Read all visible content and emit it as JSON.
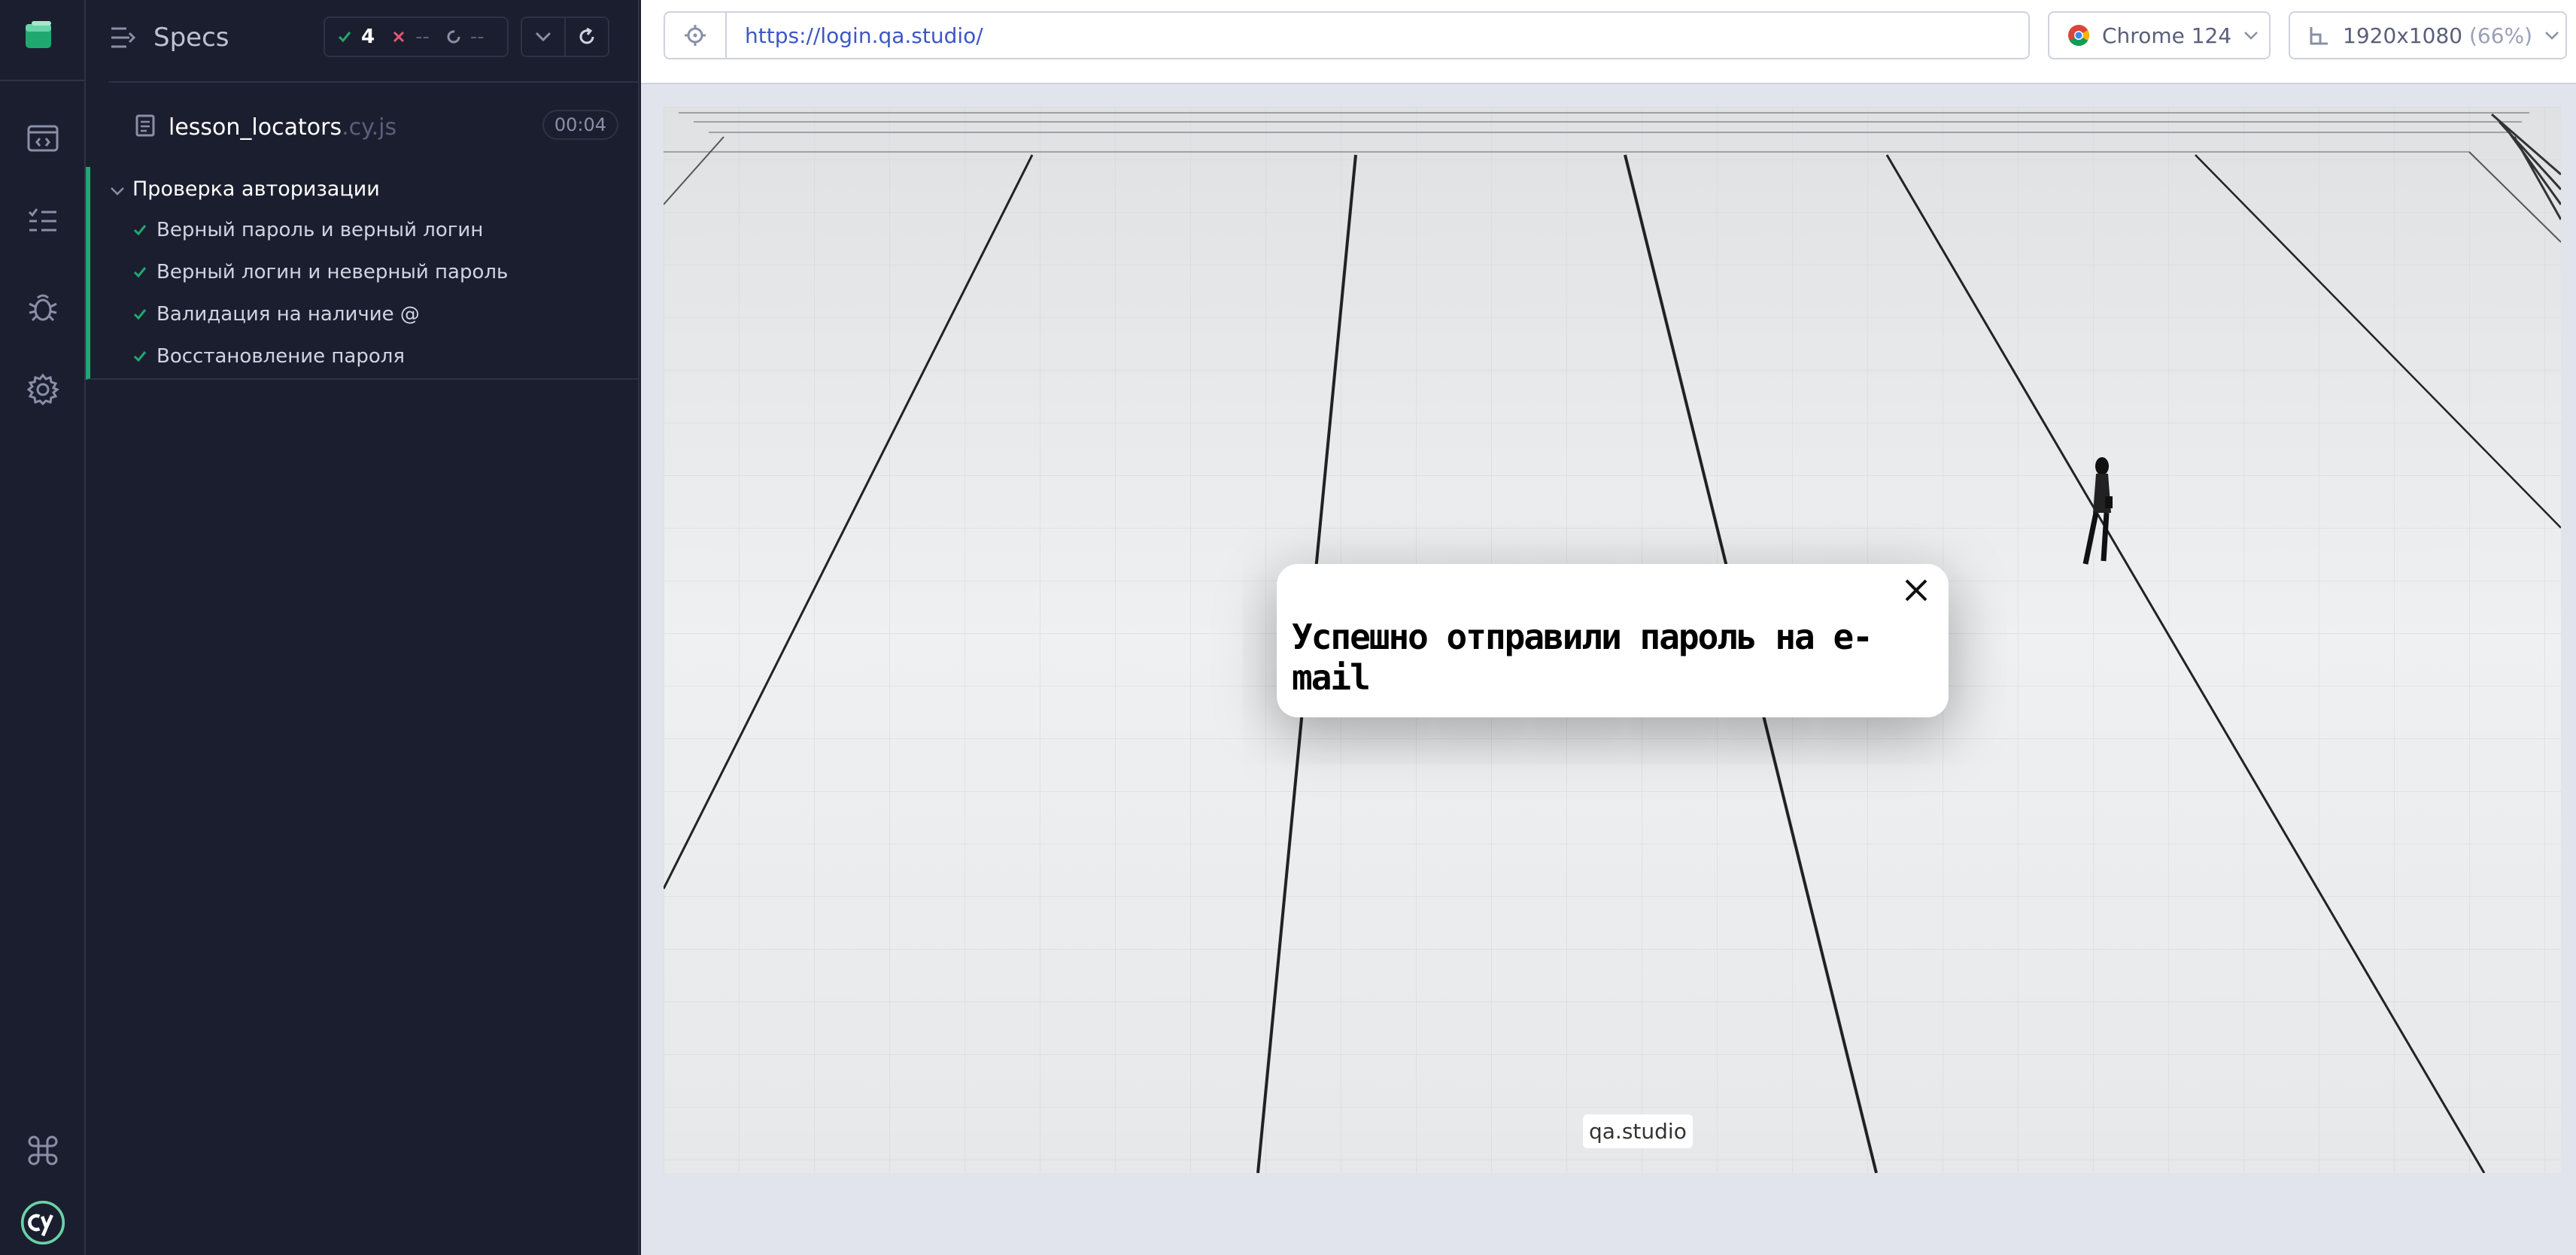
{
  "sidebar": {
    "icons": [
      "app-logo-icon",
      "browser-window-icon",
      "test-list-icon",
      "bug-icon",
      "settings-gear-icon",
      "command-icon",
      "cypress-logo-icon"
    ]
  },
  "specs_panel": {
    "title": "Specs",
    "stats": {
      "passed": "4",
      "failed": "--",
      "pending": "--"
    },
    "spec_file": {
      "name": "lesson_locators",
      "ext": ".cy.js",
      "duration": "00:04"
    },
    "suite": {
      "title": "Проверка авторизации",
      "tests": [
        {
          "label": "Верный пароль и верный логин"
        },
        {
          "label": "Верный логин и неверный пароль"
        },
        {
          "label": "Валидация на наличие @"
        },
        {
          "label": "Восстановление пароля"
        }
      ]
    }
  },
  "toolbar": {
    "url": "https://login.qa.studio/",
    "browser": "Chrome 124",
    "viewport": "1920x1080",
    "viewport_scale": "(66%)"
  },
  "app": {
    "modal_message": "Успешно отправили пароль на e-mail",
    "watermark": "qa.studio"
  },
  "colors": {
    "sidebar_bg": "#1b1e2e",
    "pass_green": "#1fa971",
    "fail_red": "#e45770",
    "url_blue": "#3d56c7"
  }
}
